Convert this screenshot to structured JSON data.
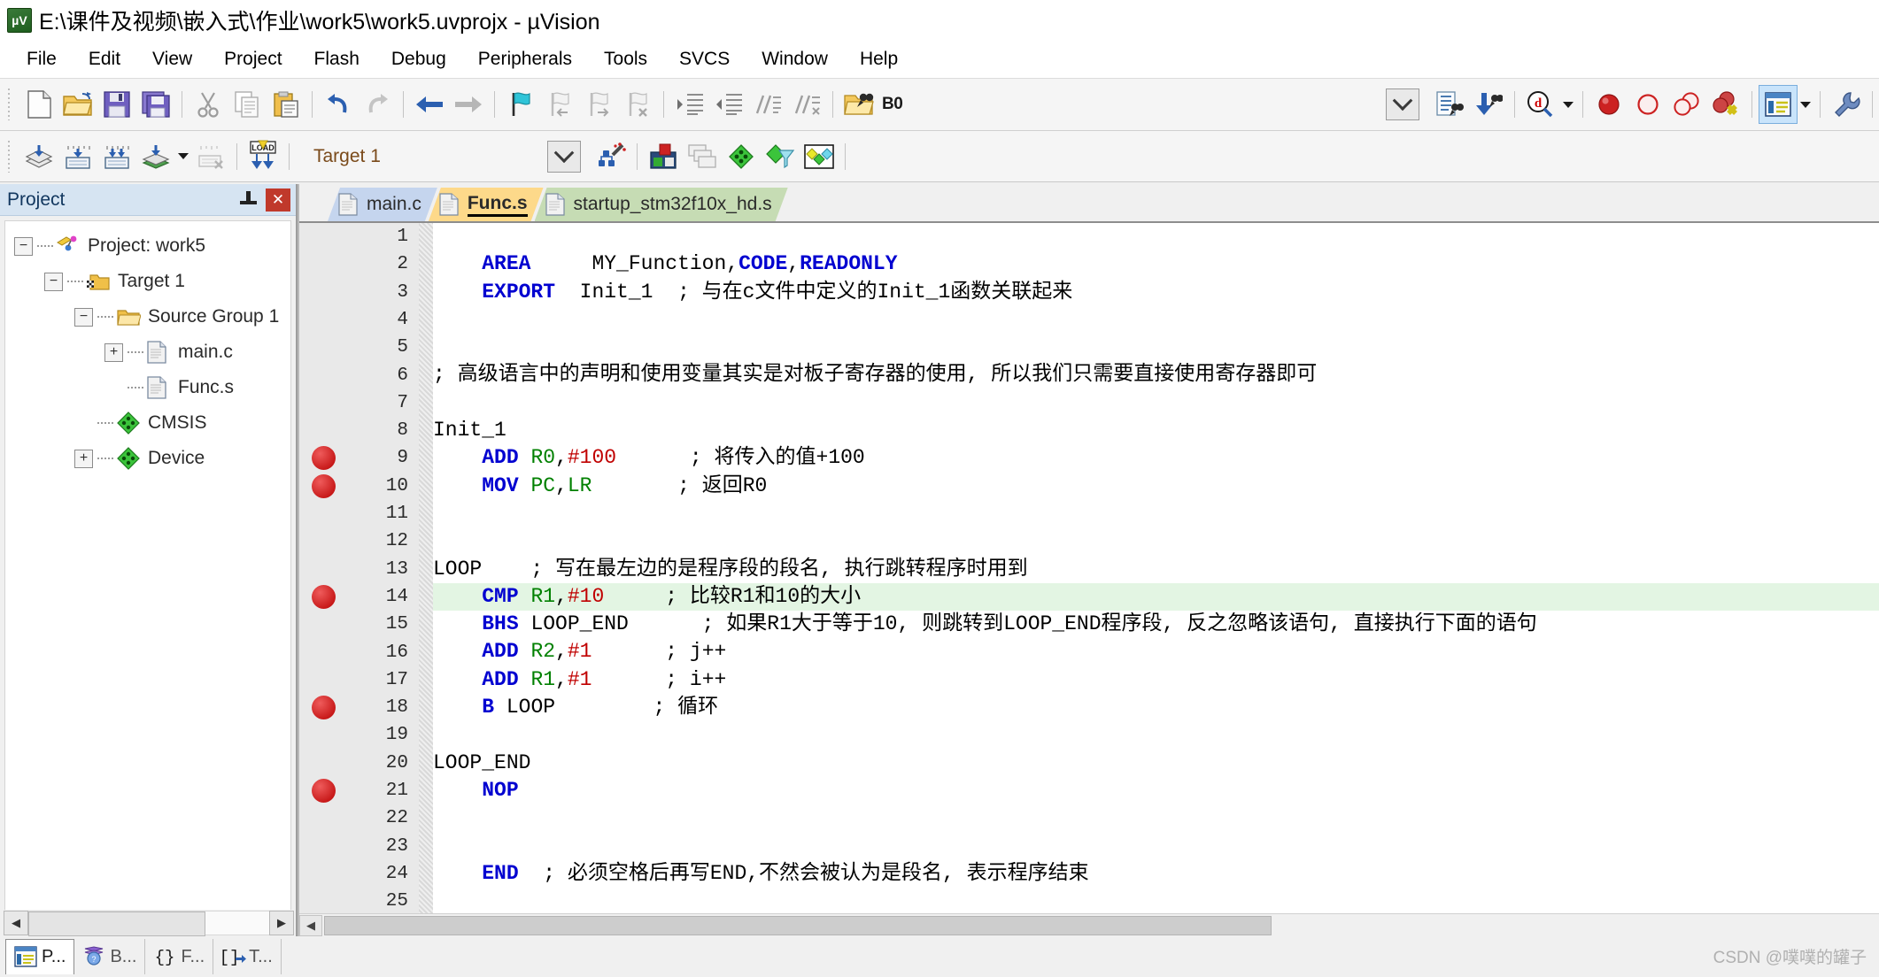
{
  "window": {
    "title": "E:\\课件及视频\\嵌入式\\作业\\work5\\work5.uvprojx - µVision",
    "app_icon": "uvision-icon"
  },
  "menubar": {
    "items": [
      {
        "label": "File"
      },
      {
        "label": "Edit"
      },
      {
        "label": "View"
      },
      {
        "label": "Project"
      },
      {
        "label": "Flash"
      },
      {
        "label": "Debug"
      },
      {
        "label": "Peripherals"
      },
      {
        "label": "Tools"
      },
      {
        "label": "SVCS"
      },
      {
        "label": "Window"
      },
      {
        "label": "Help"
      }
    ]
  },
  "toolbar_file": {
    "buttons": [
      {
        "name": "new-file-icon",
        "tip": "New"
      },
      {
        "name": "open-file-icon",
        "tip": "Open"
      },
      {
        "name": "save-icon",
        "tip": "Save"
      },
      {
        "name": "save-all-icon",
        "tip": "Save All"
      },
      {
        "name": "cut-icon",
        "tip": "Cut"
      },
      {
        "name": "copy-icon",
        "tip": "Copy"
      },
      {
        "name": "paste-icon",
        "tip": "Paste"
      },
      {
        "name": "undo-icon",
        "tip": "Undo"
      },
      {
        "name": "redo-icon",
        "tip": "Redo"
      },
      {
        "name": "navigate-back-icon",
        "tip": "Back"
      },
      {
        "name": "navigate-forward-icon",
        "tip": "Forward"
      },
      {
        "name": "bookmark-toggle-icon",
        "tip": "Insert/Remove Bookmark"
      },
      {
        "name": "bookmark-prev-icon",
        "tip": "Previous Bookmark"
      },
      {
        "name": "bookmark-next-icon",
        "tip": "Next Bookmark"
      },
      {
        "name": "bookmark-clear-icon",
        "tip": "Clear All Bookmarks"
      },
      {
        "name": "indent-icon",
        "tip": "Indent"
      },
      {
        "name": "outdent-icon",
        "tip": "Outdent"
      },
      {
        "name": "comment-icon",
        "tip": "Comment"
      },
      {
        "name": "uncomment-icon",
        "tip": "Uncomment"
      },
      {
        "name": "find-in-files-icon",
        "tip": "Find in Files"
      }
    ],
    "bookmark_field_label": "B0",
    "right_buttons": [
      {
        "name": "combo-dropdown-icon",
        "tip": "Dropdown"
      },
      {
        "name": "find-icon",
        "tip": "Find"
      },
      {
        "name": "find-next-icon",
        "tip": "Find Next"
      },
      {
        "name": "debug-find-icon",
        "tip": "Find in Debug"
      },
      {
        "name": "breakpoint-insert-icon",
        "tip": "Insert/Remove Breakpoint"
      },
      {
        "name": "breakpoint-disable-icon",
        "tip": "Enable/Disable Breakpoint"
      },
      {
        "name": "breakpoint-disable-all-icon",
        "tip": "Disable All Breakpoints"
      },
      {
        "name": "breakpoint-kill-all-icon",
        "tip": "Kill All Breakpoints"
      },
      {
        "name": "window-manager-icon",
        "tip": "Manage Windows"
      },
      {
        "name": "configuration-wizard-icon",
        "tip": "Configure"
      }
    ]
  },
  "toolbar_build": {
    "buttons": [
      {
        "name": "translate-icon",
        "tip": "Translate"
      },
      {
        "name": "build-icon",
        "tip": "Build"
      },
      {
        "name": "rebuild-icon",
        "tip": "Rebuild"
      },
      {
        "name": "batch-build-icon",
        "tip": "Batch Build"
      },
      {
        "name": "stop-build-icon",
        "tip": "Stop Build"
      },
      {
        "name": "download-icon",
        "tip": "Download"
      },
      {
        "name": "target-options-icon",
        "tip": "Options for Target"
      },
      {
        "name": "manage-project-items-icon",
        "tip": "Manage Project Items"
      },
      {
        "name": "multi-project-icon",
        "tip": "Multi-Project"
      },
      {
        "name": "pack-installer-icon",
        "tip": "Pack Installer"
      },
      {
        "name": "manage-run-environment-icon",
        "tip": "Manage Run-Time Environment"
      },
      {
        "name": "select-software-packs-icon",
        "tip": "Select Software Packs"
      }
    ],
    "download_label": "LOAD",
    "target_selector_value": "Target 1"
  },
  "project_panel": {
    "title": "Project",
    "pin_icon": "pin-icon",
    "close_icon": "close-icon",
    "tree": [
      {
        "label": "Project: work5",
        "icon": "project-icon",
        "expander": "minus",
        "depth": 0
      },
      {
        "label": "Target 1",
        "icon": "target-folder-icon",
        "expander": "minus",
        "depth": 1
      },
      {
        "label": "Source Group 1",
        "icon": "source-group-folder-icon",
        "expander": "minus",
        "depth": 2
      },
      {
        "label": "main.c",
        "icon": "c-file-icon",
        "expander": "plus",
        "depth": 3
      },
      {
        "label": "Func.s",
        "icon": "asm-file-icon",
        "expander": "none",
        "depth": 3
      },
      {
        "label": "CMSIS",
        "icon": "cmsis-component-icon",
        "expander": "none",
        "depth": 2
      },
      {
        "label": "Device",
        "icon": "device-component-icon",
        "expander": "plus",
        "depth": 2
      }
    ]
  },
  "editor": {
    "tabs": [
      {
        "label": "main.c",
        "active": false,
        "color": "#c5d5ee"
      },
      {
        "label": "Func.s",
        "active": true,
        "color": "#fdd98a"
      },
      {
        "label": "startup_stm32f10x_hd.s",
        "active": false,
        "color": "#c6dcb4"
      }
    ],
    "highlighted_line": 14,
    "breakpoint_lines": [
      9,
      10,
      14,
      18,
      21
    ],
    "lines": [
      {
        "n": 1,
        "tokens": []
      },
      {
        "n": 2,
        "tokens": [
          {
            "t": "    ",
            "c": "plain"
          },
          {
            "t": "AREA",
            "c": "kw"
          },
          {
            "t": "     MY_Function,",
            "c": "plain"
          },
          {
            "t": "CODE",
            "c": "kw"
          },
          {
            "t": ",",
            "c": "plain"
          },
          {
            "t": "READONLY",
            "c": "kw"
          }
        ]
      },
      {
        "n": 3,
        "tokens": [
          {
            "t": "    ",
            "c": "plain"
          },
          {
            "t": "EXPORT",
            "c": "kw"
          },
          {
            "t": "  Init_1  ; 与在c文件中定义的Init_1函数关联起来",
            "c": "plain"
          }
        ]
      },
      {
        "n": 4,
        "tokens": []
      },
      {
        "n": 5,
        "tokens": []
      },
      {
        "n": 6,
        "tokens": [
          {
            "t": "; 高级语言中的声明和使用变量其实是对板子寄存器的使用, 所以我们只需要直接使用寄存器即可",
            "c": "plain"
          }
        ]
      },
      {
        "n": 7,
        "tokens": []
      },
      {
        "n": 8,
        "tokens": [
          {
            "t": "Init_1",
            "c": "plain"
          }
        ]
      },
      {
        "n": 9,
        "tokens": [
          {
            "t": "    ",
            "c": "plain"
          },
          {
            "t": "ADD",
            "c": "kw"
          },
          {
            "t": " ",
            "c": "plain"
          },
          {
            "t": "R0",
            "c": "reg"
          },
          {
            "t": ",",
            "c": "plain"
          },
          {
            "t": "#100",
            "c": "num"
          },
          {
            "t": "      ; 将传入的值+100",
            "c": "plain"
          }
        ]
      },
      {
        "n": 10,
        "tokens": [
          {
            "t": "    ",
            "c": "plain"
          },
          {
            "t": "MOV",
            "c": "kw"
          },
          {
            "t": " ",
            "c": "plain"
          },
          {
            "t": "PC",
            "c": "reg"
          },
          {
            "t": ",",
            "c": "plain"
          },
          {
            "t": "LR",
            "c": "reg"
          },
          {
            "t": "       ; 返回R0",
            "c": "plain"
          }
        ]
      },
      {
        "n": 11,
        "tokens": []
      },
      {
        "n": 12,
        "tokens": []
      },
      {
        "n": 13,
        "tokens": [
          {
            "t": "LOOP    ; 写在最左边的是程序段的段名, 执行跳转程序时用到",
            "c": "plain"
          }
        ]
      },
      {
        "n": 14,
        "tokens": [
          {
            "t": "    ",
            "c": "plain"
          },
          {
            "t": "CMP",
            "c": "kw"
          },
          {
            "t": " ",
            "c": "plain"
          },
          {
            "t": "R1",
            "c": "reg"
          },
          {
            "t": ",",
            "c": "plain"
          },
          {
            "t": "#10",
            "c": "num"
          },
          {
            "t": "     ; 比较R1和10的大小",
            "c": "plain"
          }
        ]
      },
      {
        "n": 15,
        "tokens": [
          {
            "t": "    ",
            "c": "plain"
          },
          {
            "t": "BHS",
            "c": "kw"
          },
          {
            "t": " LOOP_END      ; 如果R1大于等于10, 则跳转到LOOP_END程序段, 反之忽略该语句, 直接执行下面的语句",
            "c": "plain"
          }
        ]
      },
      {
        "n": 16,
        "tokens": [
          {
            "t": "    ",
            "c": "plain"
          },
          {
            "t": "ADD",
            "c": "kw"
          },
          {
            "t": " ",
            "c": "plain"
          },
          {
            "t": "R2",
            "c": "reg"
          },
          {
            "t": ",",
            "c": "plain"
          },
          {
            "t": "#1",
            "c": "num"
          },
          {
            "t": "      ; j++",
            "c": "plain"
          }
        ]
      },
      {
        "n": 17,
        "tokens": [
          {
            "t": "    ",
            "c": "plain"
          },
          {
            "t": "ADD",
            "c": "kw"
          },
          {
            "t": " ",
            "c": "plain"
          },
          {
            "t": "R1",
            "c": "reg"
          },
          {
            "t": ",",
            "c": "plain"
          },
          {
            "t": "#1",
            "c": "num"
          },
          {
            "t": "      ; i++",
            "c": "plain"
          }
        ]
      },
      {
        "n": 18,
        "tokens": [
          {
            "t": "    ",
            "c": "plain"
          },
          {
            "t": "B",
            "c": "kw"
          },
          {
            "t": " LOOP        ; 循环",
            "c": "plain"
          }
        ]
      },
      {
        "n": 19,
        "tokens": []
      },
      {
        "n": 20,
        "tokens": [
          {
            "t": "LOOP_END",
            "c": "plain"
          }
        ]
      },
      {
        "n": 21,
        "tokens": [
          {
            "t": "    ",
            "c": "plain"
          },
          {
            "t": "NOP",
            "c": "kw"
          }
        ]
      },
      {
        "n": 22,
        "tokens": []
      },
      {
        "n": 23,
        "tokens": []
      },
      {
        "n": 24,
        "tokens": [
          {
            "t": "    ",
            "c": "plain"
          },
          {
            "t": "END",
            "c": "kw"
          },
          {
            "t": "  ; 必须空格后再写END,不然会被认为是段名, 表示程序结束",
            "c": "plain"
          }
        ]
      },
      {
        "n": 25,
        "tokens": []
      }
    ]
  },
  "bottom_tabs": [
    {
      "label": "P...",
      "icon": "project-window-icon",
      "active": true
    },
    {
      "label": "B...",
      "icon": "books-icon",
      "active": false
    },
    {
      "label": "F...",
      "icon": "functions-icon",
      "active": false
    },
    {
      "label": "T...",
      "icon": "templates-icon",
      "active": false
    }
  ],
  "watermark": "CSDN @噗噗的罐子",
  "colors": {
    "keyword": "#0000d0",
    "register": "#008000",
    "number": "#c00000",
    "highlight_line": "#e3f5e3",
    "breakpoint": "#b80000",
    "tab_active": "#fdd98a",
    "panel_header": "#d6e4f2"
  }
}
